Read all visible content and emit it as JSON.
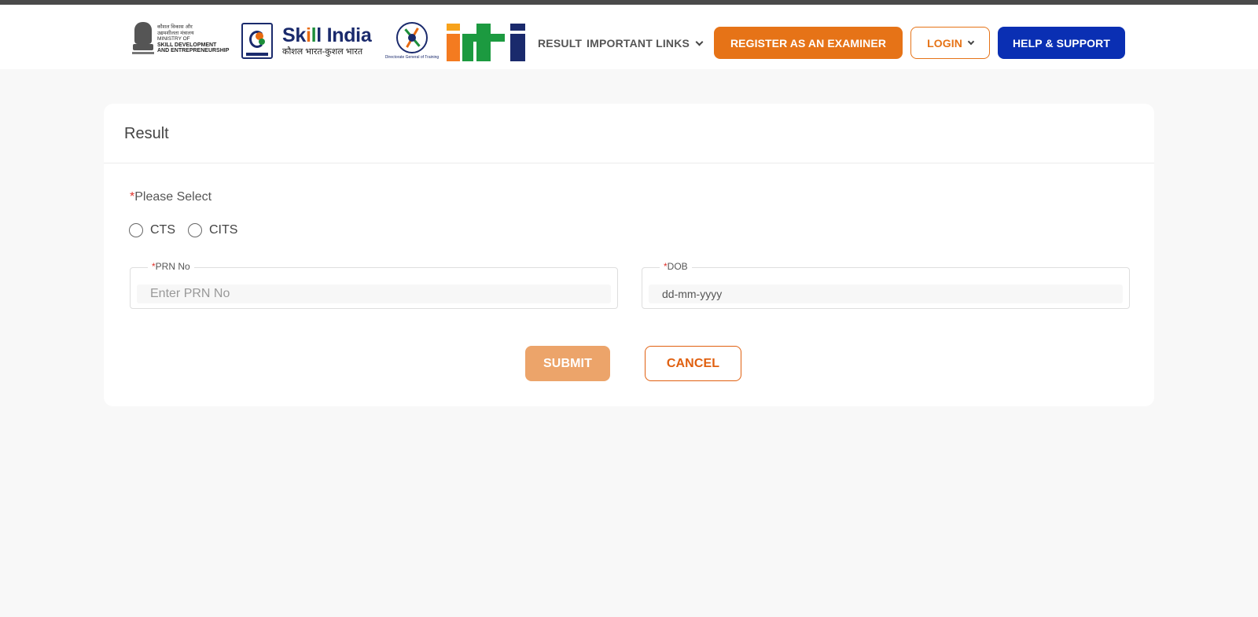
{
  "header": {
    "ministry_logo": {
      "line_hi_1": "कौशल विकास और",
      "line_hi_2": "उद्यमशीलता मंत्रालय",
      "line_1": "MINISTRY OF",
      "line_2": "SKILL DEVELOPMENT",
      "line_3": "AND ENTREPRENEURSHIP",
      "motto": "सत्यमेव जयते",
      "icon": "national-emblem-icon"
    },
    "skill_india_logo": {
      "text_prefix": "Sk",
      "text_i1": "i",
      "text_l": "l",
      "text_suffix": "l India",
      "tagline": "कौशल भारत-कुशल भारत",
      "icon": "skill-india-icon"
    },
    "dgt_logo": {
      "text": "Directorate General of Training",
      "icon": "dgt-wheel-icon"
    },
    "iti_logo": {
      "icon": "iti-logo-icon",
      "colors": [
        "#f47b20",
        "#1c9a40",
        "#1a2a6c"
      ]
    },
    "nav": {
      "result": "RESULT",
      "important_links": "IMPORTANT LINKS"
    },
    "buttons": {
      "register": "REGISTER AS AN EXAMINER",
      "login": "LOGIN",
      "help": "HELP & SUPPORT"
    },
    "colors": {
      "orange": "#e67317",
      "blue": "#0a2fb3"
    }
  },
  "card": {
    "title": "Result",
    "select_label": "Please Select",
    "required_mark": "*",
    "radio_options": [
      {
        "label": "CTS",
        "checked": false
      },
      {
        "label": "CITS",
        "checked": false
      }
    ],
    "prn": {
      "label": "PRN No",
      "placeholder": "Enter PRN No"
    },
    "dob": {
      "label": "DOB",
      "placeholder": "dd-mm-yyyy"
    },
    "submit": "SUBMIT",
    "cancel": "CANCEL"
  }
}
